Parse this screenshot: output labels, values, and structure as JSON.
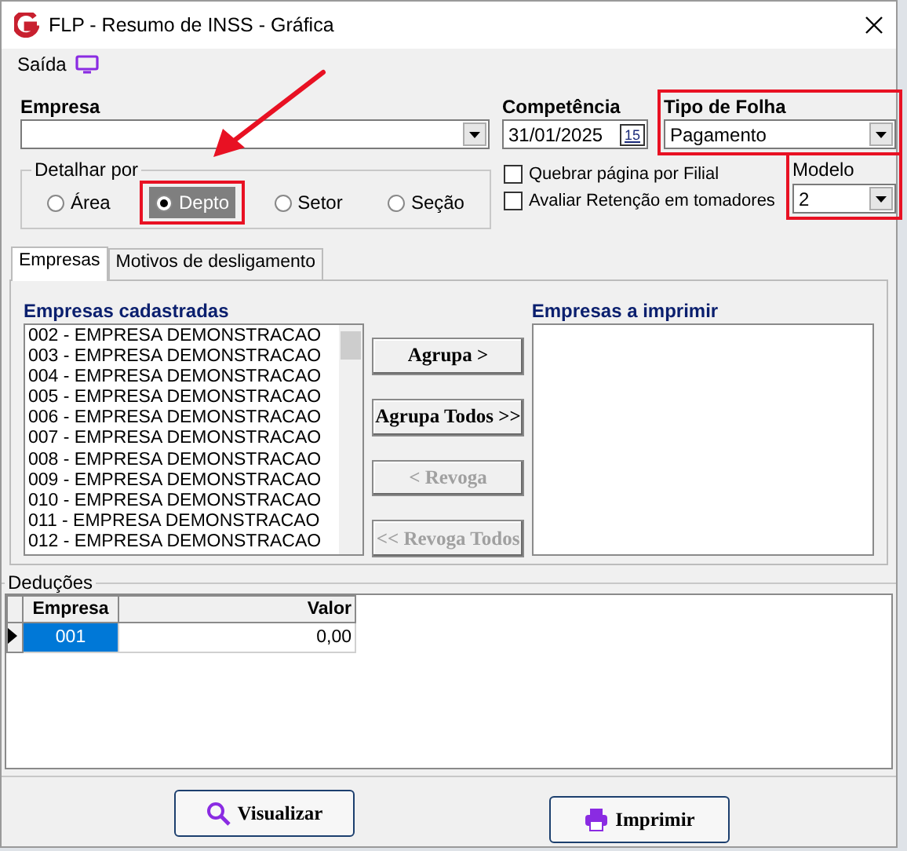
{
  "window": {
    "title": "FLP - Resumo de INSS - Gráfica"
  },
  "menu": [
    {
      "label": "Saída"
    }
  ],
  "empresa": {
    "label": "Empresa"
  },
  "competencia": {
    "label": "Competência",
    "value": "31/01/2025",
    "calendar_day": "15"
  },
  "tipo_de_folha": {
    "label": "Tipo de Folha",
    "value": "Pagamento",
    "highlighted": true
  },
  "detalhar_por": {
    "label": "Detalhar por",
    "options": [
      {
        "label": "Área",
        "selected": false,
        "highlighted": false
      },
      {
        "label": "Depto",
        "selected": true,
        "highlighted": true
      },
      {
        "label": "Setor",
        "selected": false,
        "highlighted": false
      },
      {
        "label": "Seção",
        "selected": false,
        "highlighted": false
      }
    ]
  },
  "checkboxes": [
    {
      "label": "Quebrar página por Filial",
      "checked": false
    },
    {
      "label": "Avaliar Retenção em tomadores",
      "checked": false
    }
  ],
  "modelo": {
    "label": "Modelo",
    "value": "2",
    "highlighted": true
  },
  "annotation_arrow": true,
  "tabs": [
    {
      "label": "Empresas",
      "selected": true
    },
    {
      "label": "Motivos de desligamento",
      "selected": false
    }
  ],
  "empresas_cadastradas": {
    "title": "Empresas cadastradas",
    "items": [
      "002 - EMPRESA DEMONSTRACAO",
      "003 - EMPRESA DEMONSTRACAO",
      "004 - EMPRESA DEMONSTRACAO",
      "005 - EMPRESA DEMONSTRACAO",
      "006 - EMPRESA DEMONSTRACAO",
      "007 - EMPRESA DEMONSTRACAO",
      "008 - EMPRESA DEMONSTRACAO",
      "009 - EMPRESA DEMONSTRACAO",
      "010 - EMPRESA DEMONSTRACAO",
      "011 - EMPRESA DEMONSTRACAO",
      "012 - EMPRESA DEMONSTRACAO"
    ]
  },
  "actions": [
    {
      "label": "Agrupa >",
      "disabled": false
    },
    {
      "label": "Agrupa Todos >>",
      "disabled": false
    },
    {
      "label": "< Revoga",
      "disabled": true
    },
    {
      "label": "<< Revoga Todos",
      "disabled": true
    }
  ],
  "empresas_a_imprimir": {
    "title": "Empresas a imprimir"
  },
  "deducoes": {
    "title": "Deduções",
    "columns": [
      "Empresa",
      "Valor"
    ],
    "rows": [
      {
        "empresa": "001",
        "valor": "0,00",
        "selected": true
      }
    ]
  },
  "buttons": [
    {
      "label": "Visualizar",
      "kind": "search"
    },
    {
      "label": "Imprimir",
      "kind": "print"
    }
  ]
}
